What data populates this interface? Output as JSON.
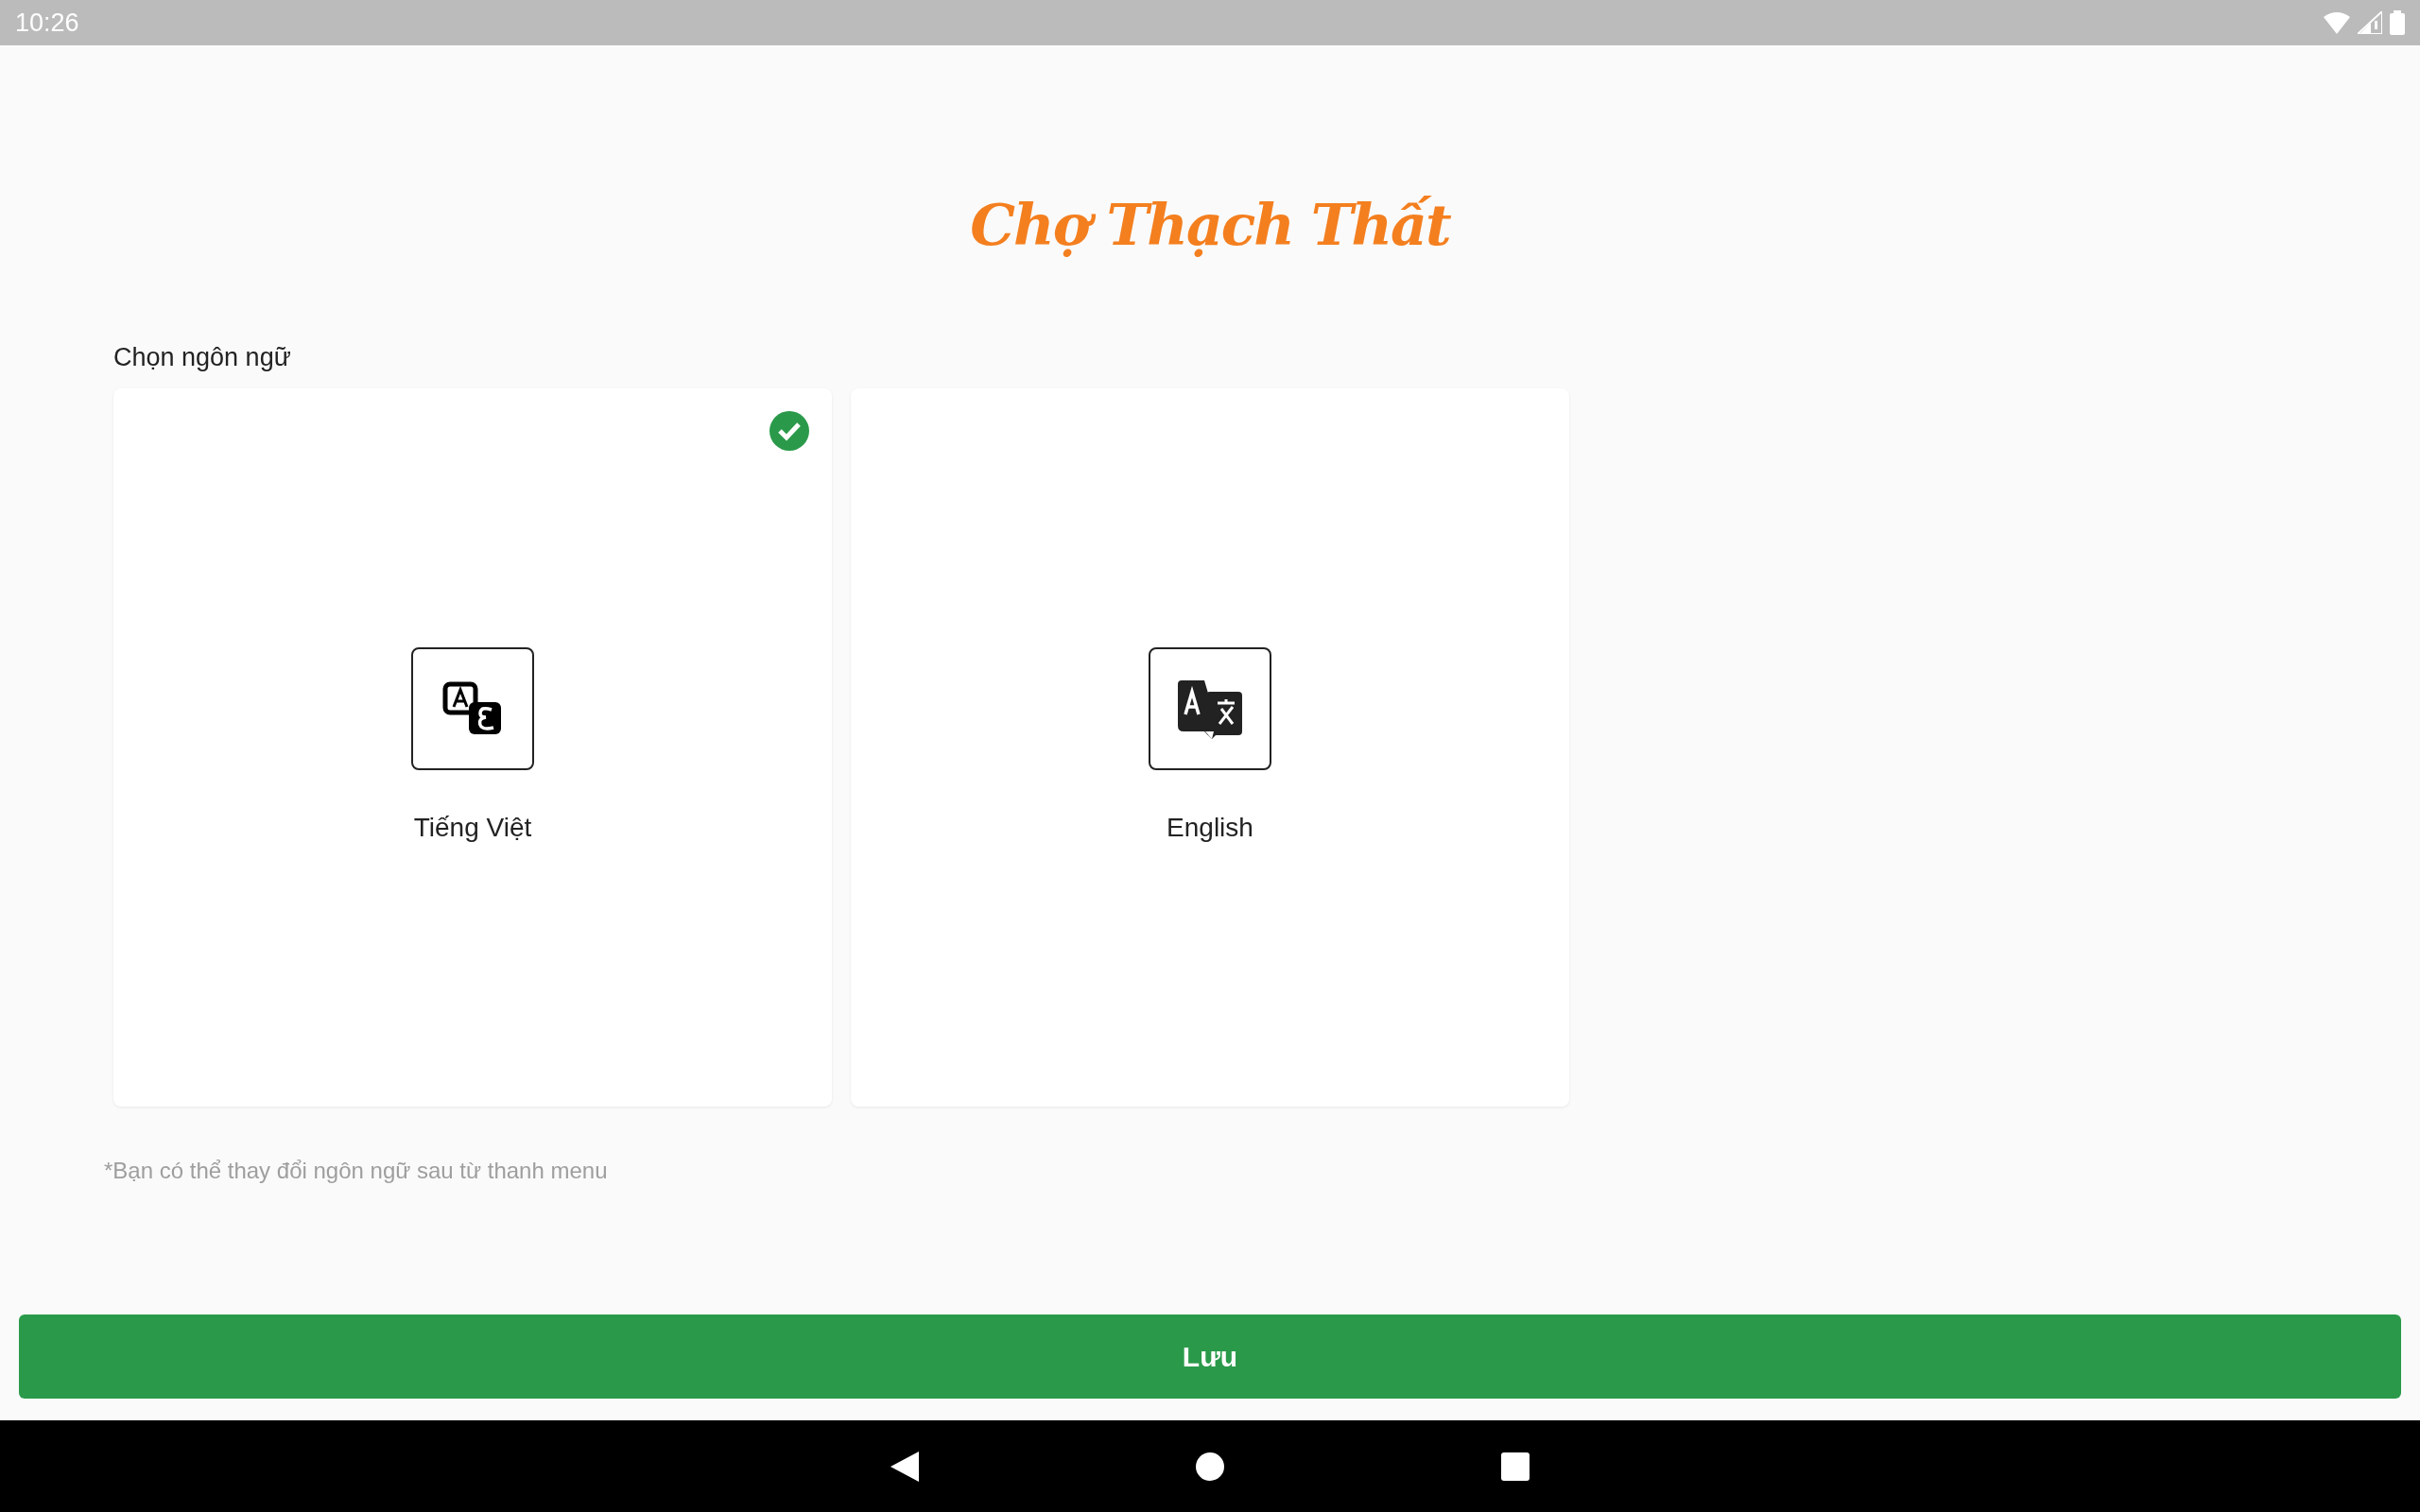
{
  "status_bar": {
    "time": "10:26"
  },
  "logo": "Chợ Thạch Thất",
  "section_label": "Chọn ngôn ngữ",
  "languages": [
    {
      "label": "Tiếng Việt",
      "kind": "script",
      "selected": true
    },
    {
      "label": "English",
      "kind": "translate",
      "selected": false
    }
  ],
  "note": "*Bạn có thể thay đổi ngôn ngữ sau từ thanh menu",
  "save_button": "Lưu"
}
